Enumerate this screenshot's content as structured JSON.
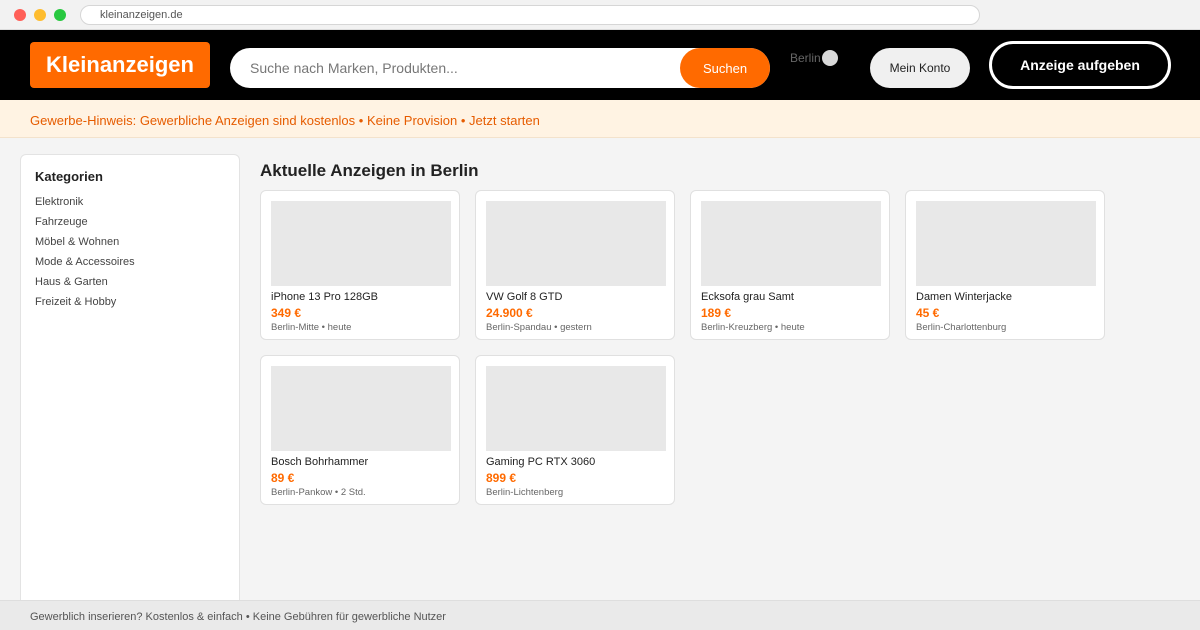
{
  "browser": {
    "url": "kleinanzeigen.de"
  },
  "header": {
    "logo": "Kleinanzeigen",
    "search_placeholder": "Suche nach Marken, Produkten...",
    "search_value": "",
    "search_button": "Suchen",
    "location": "Berlin",
    "account_button": "Mein Konto",
    "post_button": "Anzeige aufgeben"
  },
  "banner": {
    "text": "Gewerbe-Hinweis: Gewerbliche Anzeigen sind kostenlos • Keine Provision • Jetzt starten"
  },
  "sidebar": {
    "title": "Kategorien",
    "items": [
      "Elektronik",
      "Fahrzeuge",
      "Möbel & Wohnen",
      "Mode & Accessoires",
      "Haus & Garten",
      "Freizeit & Hobby"
    ]
  },
  "main": {
    "title": "Aktuelle Anzeigen in Berlin",
    "listings": [
      {
        "title": "iPhone 13 Pro 128GB",
        "price": "349 €",
        "meta": "Berlin-Mitte • heute"
      },
      {
        "title": "VW Golf 8 GTD",
        "price": "24.900 €",
        "meta": "Berlin-Spandau • gestern"
      },
      {
        "title": "Ecksofa grau Samt",
        "price": "189 €",
        "meta": "Berlin-Kreuzberg • heute"
      },
      {
        "title": "Damen Winterjacke",
        "price": "45 €",
        "meta": "Berlin-Charlottenburg"
      },
      {
        "title": "Bosch Bohrhammer",
        "price": "89 €",
        "meta": "Berlin-Pankow • 2 Std."
      },
      {
        "title": "Gaming PC RTX 3060",
        "price": "899 €",
        "meta": "Berlin-Lichtenberg"
      }
    ]
  },
  "footer": {
    "text": "Gewerblich inserieren? Kostenlos & einfach • Keine Gebühren für gewerbliche Nutzer"
  },
  "colors": {
    "brand": "#ff6a00",
    "header_bg": "#000000",
    "banner_bg": "#fff3e3"
  }
}
